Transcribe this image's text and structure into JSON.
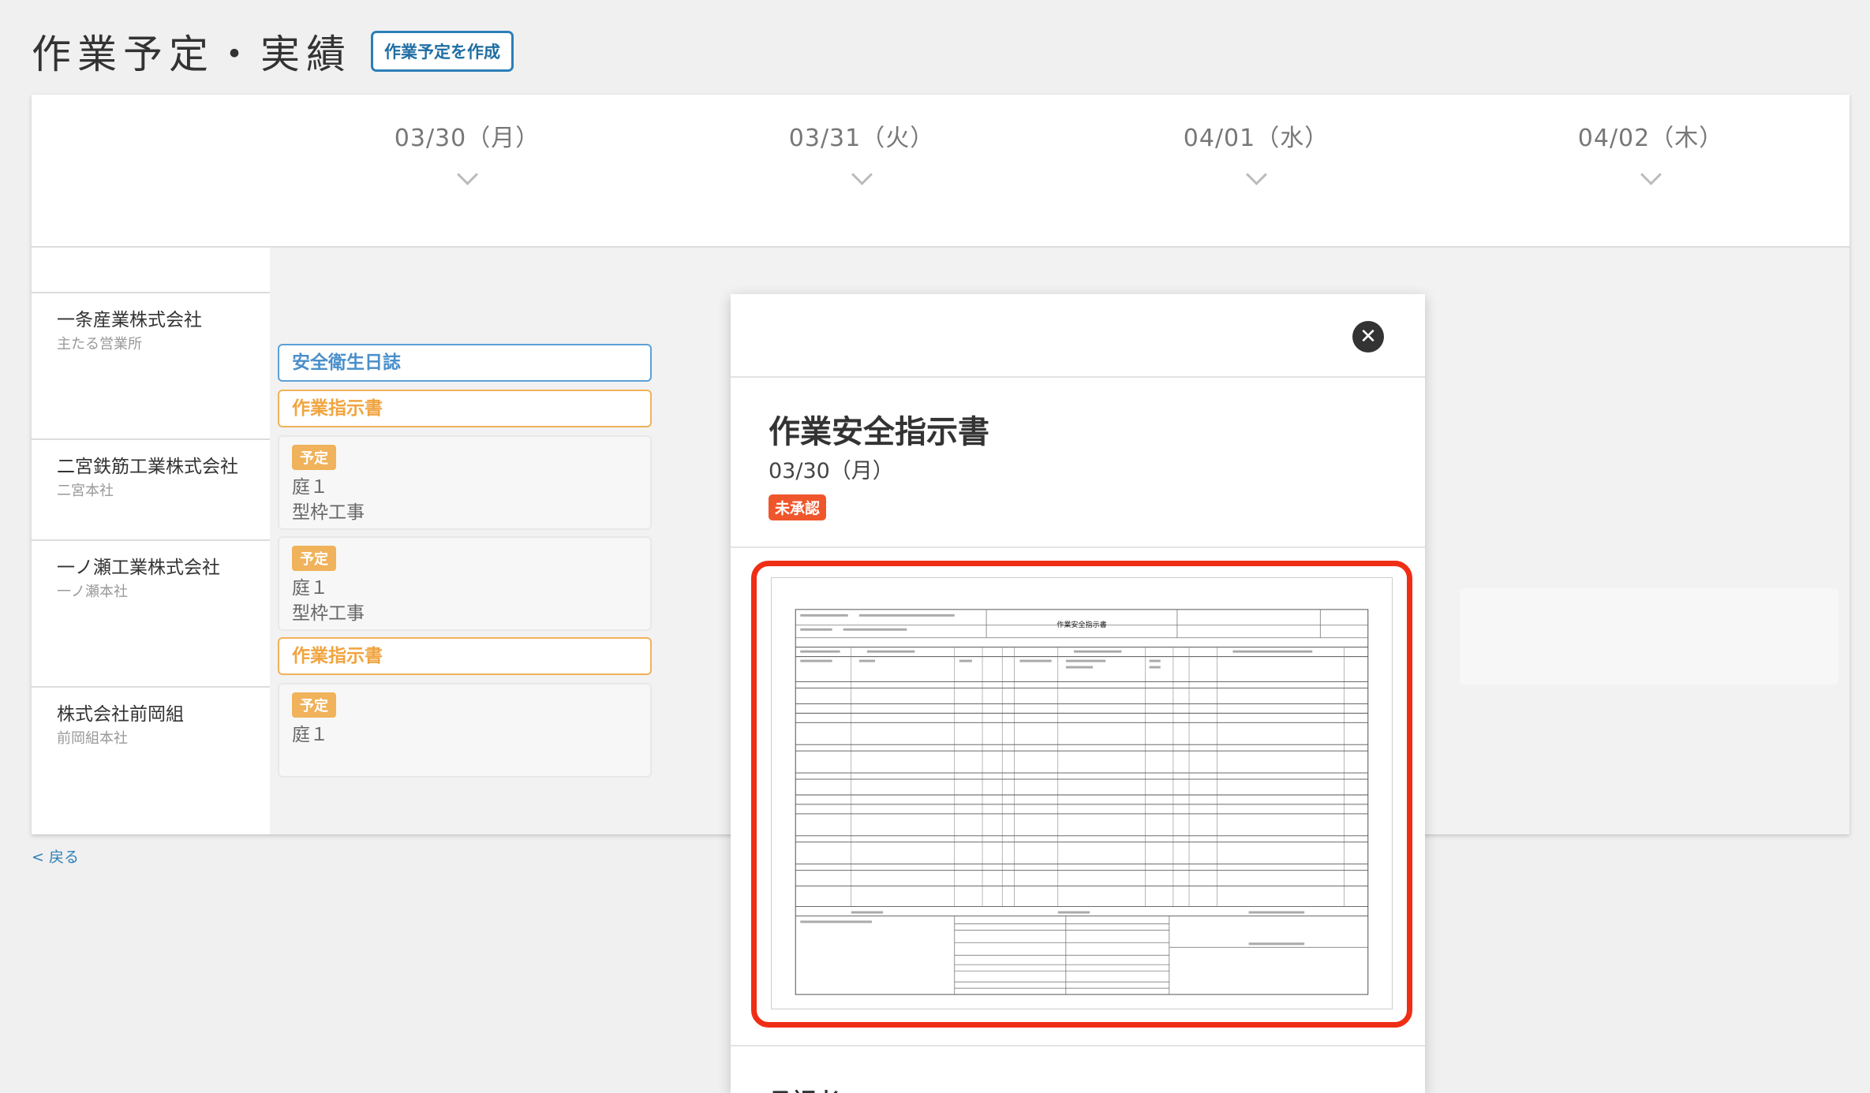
{
  "header": {
    "title": "作業予定・実績",
    "create_button": "作業予定を作成"
  },
  "days": [
    {
      "label": "03/30（月）"
    },
    {
      "label": "03/31（火）"
    },
    {
      "label": "04/01（水）"
    },
    {
      "label": "04/02（木）"
    }
  ],
  "companies": [
    {
      "name": "一条産業株式会社",
      "office": "主たる営業所"
    },
    {
      "name": "二宮鉄筋工業株式会社",
      "office": "二宮本社"
    },
    {
      "name": "一ノ瀬工業株式会社",
      "office": "一ノ瀬本社"
    },
    {
      "name": "株式会社前岡組",
      "office": "前岡組本社"
    }
  ],
  "chips": {
    "safety_log": "安全衛生日誌",
    "instruction_1": "作業指示書",
    "instruction_2": "作業指示書"
  },
  "cards": [
    {
      "tag": "予定",
      "place": "庭１",
      "work": "型枠工事"
    },
    {
      "tag": "予定",
      "place": "庭１",
      "work": "型枠工事"
    },
    {
      "tag": "予定",
      "place": "庭１"
    }
  ],
  "back_link": "< 戻る",
  "modal": {
    "title": "作業安全指示書",
    "date": "03/30（月）",
    "status": "未承認",
    "doc_title": "作業安全指示書",
    "approver_heading": "承認者",
    "close_glyph": "✕"
  },
  "colors": {
    "accent_blue": "#2c7fb8",
    "orange": "#f0b25a",
    "status_red": "#f0562c",
    "highlight_red": "#ef2e16"
  }
}
